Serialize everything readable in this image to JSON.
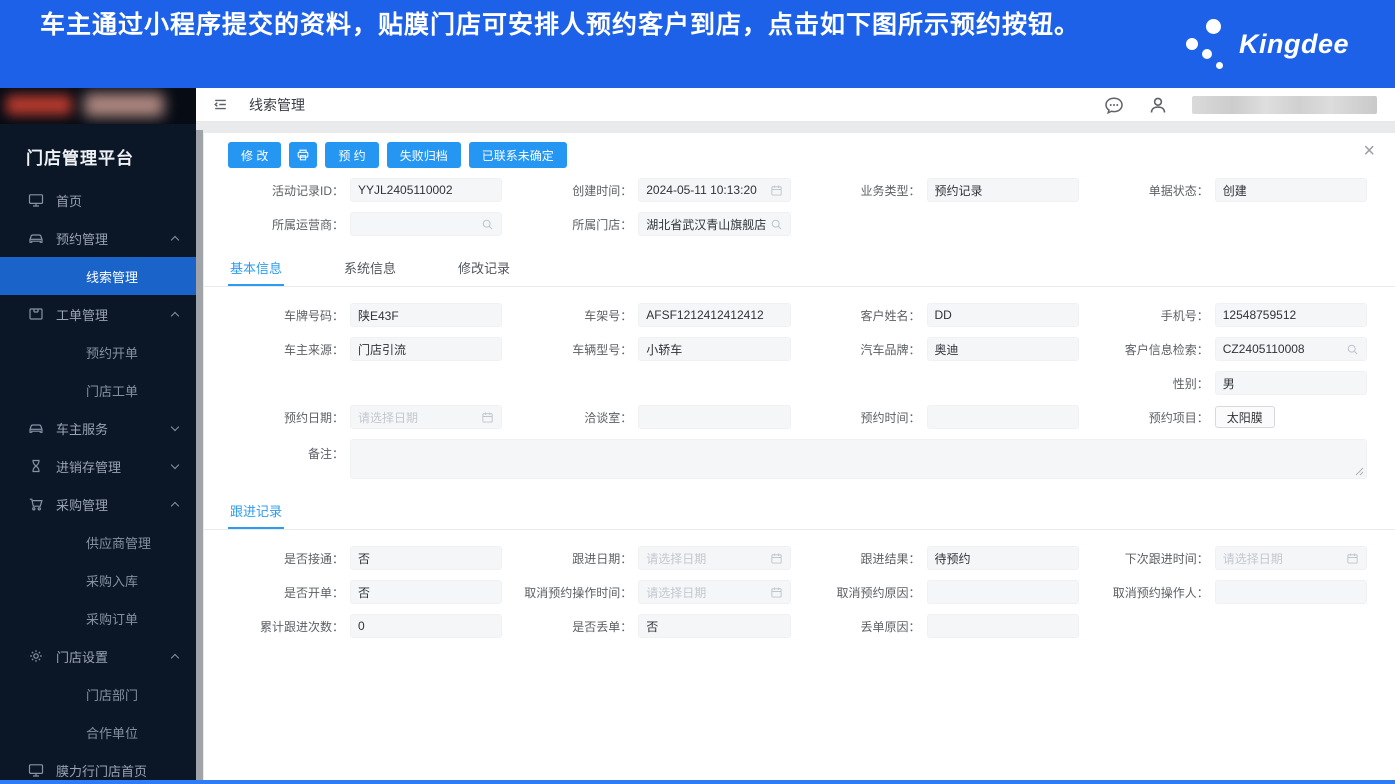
{
  "banner": {
    "text": "车主通过小程序提交的资料，贴膜门店可安排人预约客户到店，点击如下图所示预约按钮。",
    "brand": "Kingdee"
  },
  "sidebar": {
    "title": "门店管理平台",
    "items": [
      {
        "label": "首页",
        "icon": "monitor-icon",
        "level": "top"
      },
      {
        "label": "预约管理",
        "icon": "car-icon",
        "level": "top",
        "expanded": true
      },
      {
        "label": "线索管理",
        "level": "sub",
        "active": true
      },
      {
        "label": "工单管理",
        "icon": "workorder-icon",
        "level": "top",
        "expanded": true
      },
      {
        "label": "预约开单",
        "level": "sub"
      },
      {
        "label": "门店工单",
        "level": "sub"
      },
      {
        "label": "车主服务",
        "icon": "car-icon",
        "level": "top",
        "expanded": false
      },
      {
        "label": "进销存管理",
        "icon": "hourglass-icon",
        "level": "top",
        "expanded": false
      },
      {
        "label": "采购管理",
        "icon": "cart-icon",
        "level": "top",
        "expanded": true
      },
      {
        "label": "供应商管理",
        "level": "sub"
      },
      {
        "label": "采购入库",
        "level": "sub"
      },
      {
        "label": "采购订单",
        "level": "sub"
      },
      {
        "label": "门店设置",
        "icon": "gear-icon",
        "level": "top",
        "expanded": true
      },
      {
        "label": "门店部门",
        "level": "sub"
      },
      {
        "label": "合作单位",
        "level": "sub"
      },
      {
        "label": "膜力行门店首页",
        "icon": "monitor-icon",
        "level": "top"
      }
    ]
  },
  "topbar": {
    "title": "线索管理"
  },
  "toolbar": {
    "modify": "修 改",
    "reserve": "预 约",
    "fail_archive": "失败归档",
    "contacted_unconfirmed": "已联系未确定",
    "close": "×"
  },
  "record": {
    "activity_id": {
      "label": "活动记录ID：",
      "value": "YYJL2405110002"
    },
    "create_time": {
      "label": "创建时间：",
      "value": "2024-05-11 10:13:20",
      "icon": "calendar-icon"
    },
    "biz_type": {
      "label": "业务类型：",
      "value": "预约记录"
    },
    "doc_status": {
      "label": "单据状态：",
      "value": "创建"
    },
    "operator": {
      "label": "所属运营商：",
      "value": "",
      "icon": "search-icon"
    },
    "store": {
      "label": "所属门店：",
      "value": "湖北省武汉青山旗舰店",
      "icon": "search-icon"
    }
  },
  "tabs": {
    "basic": "基本信息",
    "system": "系统信息",
    "modify_log": "修改记录"
  },
  "basic": {
    "plate": {
      "label": "车牌号码：",
      "value": "陕E43F"
    },
    "vin": {
      "label": "车架号：",
      "value": "AFSF1212412412412"
    },
    "customer_name": {
      "label": "客户姓名：",
      "value": "DD"
    },
    "phone": {
      "label": "手机号：",
      "value": "12548759512"
    },
    "owner_source": {
      "label": "车主来源：",
      "value": "门店引流"
    },
    "vehicle_model": {
      "label": "车辆型号：",
      "value": "小轿车"
    },
    "car_brand": {
      "label": "汽车品牌：",
      "value": "奥迪"
    },
    "customer_search": {
      "label": "客户信息检索：",
      "value": "CZ2405110008",
      "icon": "search-icon"
    },
    "gender": {
      "label": "性别：",
      "value": "男"
    },
    "appt_date": {
      "label": "预约日期：",
      "placeholder": "请选择日期",
      "icon": "calendar-icon"
    },
    "meeting_room": {
      "label": "洽谈室：",
      "value": ""
    },
    "appt_time": {
      "label": "预约时间：",
      "value": ""
    },
    "appt_item": {
      "label": "预约项目：",
      "value": "太阳膜"
    },
    "remark": {
      "label": "备注：",
      "value": ""
    }
  },
  "followup": {
    "tab": "跟进记录",
    "connected": {
      "label": "是否接通：",
      "value": "否"
    },
    "follow_date": {
      "label": "跟进日期：",
      "placeholder": "请选择日期",
      "icon": "calendar-icon"
    },
    "follow_result": {
      "label": "跟进结果：",
      "value": "待预约"
    },
    "next_follow_time": {
      "label": "下次跟进时间：",
      "placeholder": "请选择日期",
      "icon": "calendar-icon"
    },
    "billed": {
      "label": "是否开单：",
      "value": "否"
    },
    "cancel_op_time": {
      "label": "取消预约操作时间：",
      "placeholder": "请选择日期",
      "icon": "calendar-icon"
    },
    "cancel_reason": {
      "label": "取消预约原因：",
      "value": ""
    },
    "cancel_operator": {
      "label": "取消预约操作人：",
      "value": ""
    },
    "follow_count": {
      "label": "累计跟进次数：",
      "value": "0"
    },
    "lost": {
      "label": "是否丢单：",
      "value": "否"
    },
    "lost_reason": {
      "label": "丢单原因：",
      "value": ""
    }
  },
  "colors": {
    "banner_blue": "#1c61e8",
    "button_blue": "#2596f2",
    "active_nav_blue": "#1a63c8",
    "sidebar_bg": "#0b1626",
    "tab_active_blue": "#2d9cf0"
  }
}
